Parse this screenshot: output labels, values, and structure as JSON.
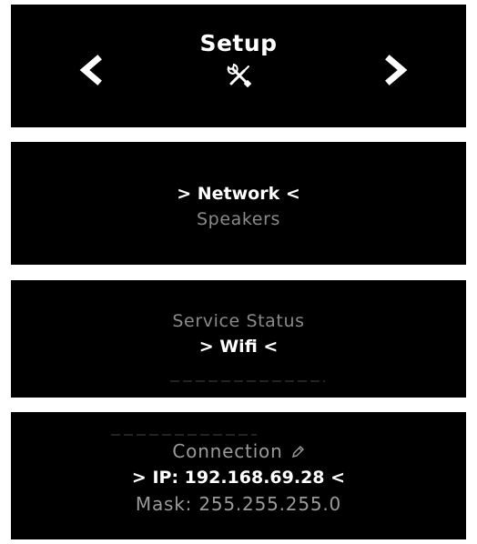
{
  "screens": [
    {
      "title": "Setup",
      "icon": "tools-icon",
      "prev": "chevron-left-icon",
      "next": "chevron-right-icon"
    },
    {
      "selected": "> Network <",
      "next_item": "Speakers"
    },
    {
      "prev_item": "Service Status",
      "selected": "> Wifi <"
    },
    {
      "prev_item": "Connection",
      "prev_icon": "pencil-icon",
      "selected": "> IP: 192.168.69.28 <",
      "next_item": "Mask: 255.255.255.0"
    }
  ]
}
